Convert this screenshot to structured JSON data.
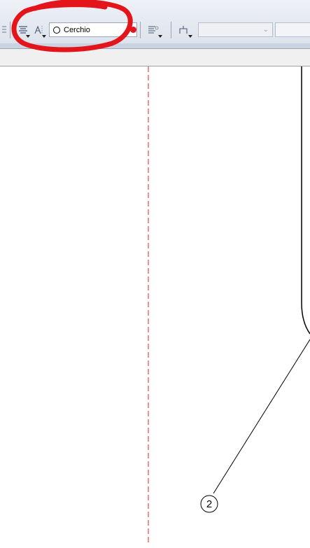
{
  "toolbar": {
    "text_style_combo": {
      "value": "Cerchio",
      "icon": "circle-icon"
    },
    "align_button_icon": "text-align-icon",
    "text_height_button_icon": "text-height-icon",
    "leader_style_button_icon": "leader-style-icon",
    "bracket_button_icon": "bracket-icon",
    "layer_combo": {
      "value": ""
    },
    "annotation_highlight_color": "#e4141b"
  },
  "drawing": {
    "balloon_label": "2",
    "centerline_color": "#e02020",
    "line_color": "#000000"
  }
}
